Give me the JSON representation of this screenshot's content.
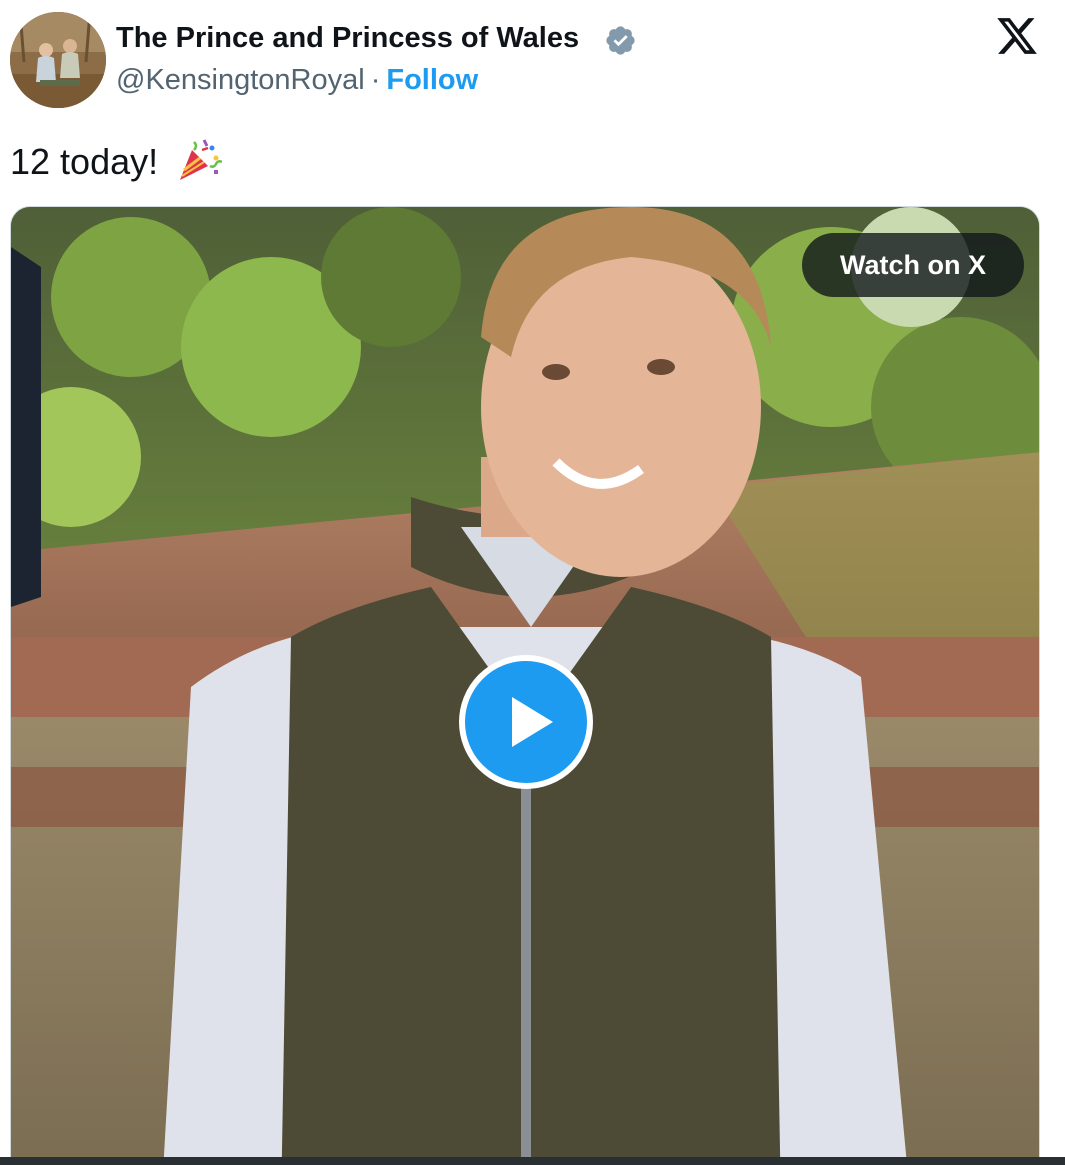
{
  "author": {
    "name": "The Prince and Princess of Wales",
    "handle": "@KensingtonRoyal",
    "separator": "·",
    "follow_label": "Follow",
    "avatar_icon": "profile-photo",
    "verified_icon": "verified-badge-icon",
    "verified_color": "#829aab"
  },
  "platform": {
    "logo_icon": "x-logo-icon"
  },
  "tweet": {
    "text": "12 today!",
    "emoji_icon": "party-popper-icon"
  },
  "media": {
    "type": "video",
    "watch_label": "Watch on X",
    "play_icon": "play-icon",
    "play_color": "#1d9bf0"
  },
  "colors": {
    "text": "#0f1419",
    "secondary": "#536471",
    "accent": "#1d9bf0"
  }
}
